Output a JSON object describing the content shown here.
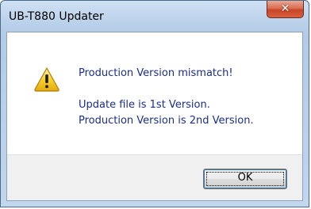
{
  "window": {
    "title": "UB-T880 Updater",
    "close_icon": "close-icon"
  },
  "dialog": {
    "icon": "warning-icon",
    "heading": "Production Version mismatch!",
    "line1": "Update file is 1st Version.",
    "line2": "Production Version is 2nd Version."
  },
  "buttons": {
    "ok_label": "OK"
  },
  "colors": {
    "message_text": "#1a2e8a",
    "close_button": "#c84526",
    "title_bar": "#b9d0ea",
    "footer": "#f0f0f0"
  }
}
